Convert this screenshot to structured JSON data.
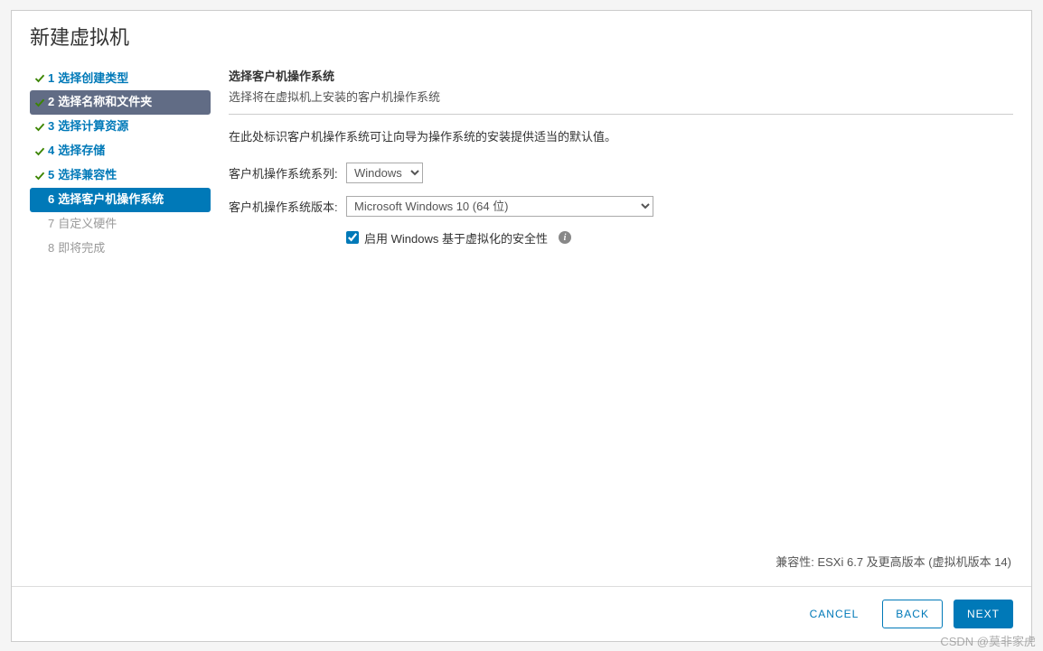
{
  "dialog": {
    "title": "新建虚拟机"
  },
  "steps": [
    {
      "num": "1",
      "label": "选择创建类型",
      "state": "done"
    },
    {
      "num": "2",
      "label": "选择名称和文件夹",
      "state": "highlight"
    },
    {
      "num": "3",
      "label": "选择计算资源",
      "state": "done"
    },
    {
      "num": "4",
      "label": "选择存储",
      "state": "done"
    },
    {
      "num": "5",
      "label": "选择兼容性",
      "state": "done"
    },
    {
      "num": "6",
      "label": "选择客户机操作系统",
      "state": "current"
    },
    {
      "num": "7",
      "label": "自定义硬件",
      "state": "future"
    },
    {
      "num": "8",
      "label": "即将完成",
      "state": "future"
    }
  ],
  "content": {
    "title": "选择客户机操作系统",
    "subtitle": "选择将在虚拟机上安装的客户机操作系统",
    "hint": "在此处标识客户机操作系统可让向导为操作系统的安装提供适当的默认值。",
    "family_label": "客户机操作系统系列:",
    "family_value": "Windows",
    "version_label": "客户机操作系统版本:",
    "version_value": "Microsoft Windows 10 (64 位)",
    "security_checkbox_label": "启用 Windows 基于虚拟化的安全性",
    "security_checked": true,
    "compatibility": "兼容性: ESXi 6.7 及更高版本 (虚拟机版本 14)"
  },
  "footer": {
    "cancel": "CANCEL",
    "back": "BACK",
    "next": "NEXT"
  },
  "watermark": "CSDN @莫非家虎"
}
